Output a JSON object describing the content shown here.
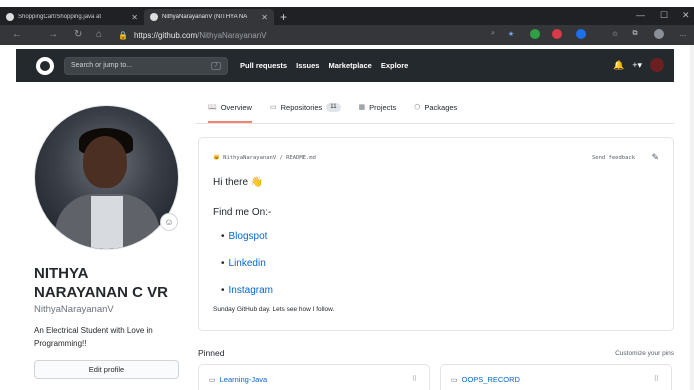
{
  "browser": {
    "tabs": [
      {
        "title": "ShoppingCart/Shopping.java at"
      },
      {
        "title": "NithyaNarayananV (NITHYA NA"
      }
    ],
    "url": {
      "host": "https://github.com",
      "path": "/NithyaNarayananV"
    }
  },
  "github": {
    "search_placeholder": "Search or jump to...",
    "search_shortcut": "/",
    "nav": [
      "Pull requests",
      "Issues",
      "Marketplace",
      "Explore"
    ]
  },
  "profile_tabs": [
    {
      "label": "Overview",
      "icon": "book-icon"
    },
    {
      "label": "Repositories",
      "icon": "repo-icon",
      "count": "11"
    },
    {
      "label": "Projects",
      "icon": "project-icon"
    },
    {
      "label": "Packages",
      "icon": "package-icon"
    }
  ],
  "profile": {
    "full_name": "NITHYA NARAYANAN C VR",
    "login": "NithyaNarayananV",
    "bio": "An Electrical Student with Love in Programming!!",
    "edit_button": "Edit profile"
  },
  "readme": {
    "path": "NithyaNarayananV / README.md",
    "feedback": "Send feedback",
    "greeting": "Hi there",
    "find_me": "Find me On:-",
    "links": [
      "Blogspot",
      "Linkedin",
      "Instagram"
    ],
    "footer": "Sunday GitHub day. Lets see how I follow."
  },
  "pinned": {
    "label": "Pinned",
    "customize": "Customize your pins",
    "repos": [
      "Learning-Java",
      "OOPS_RECORD"
    ]
  }
}
